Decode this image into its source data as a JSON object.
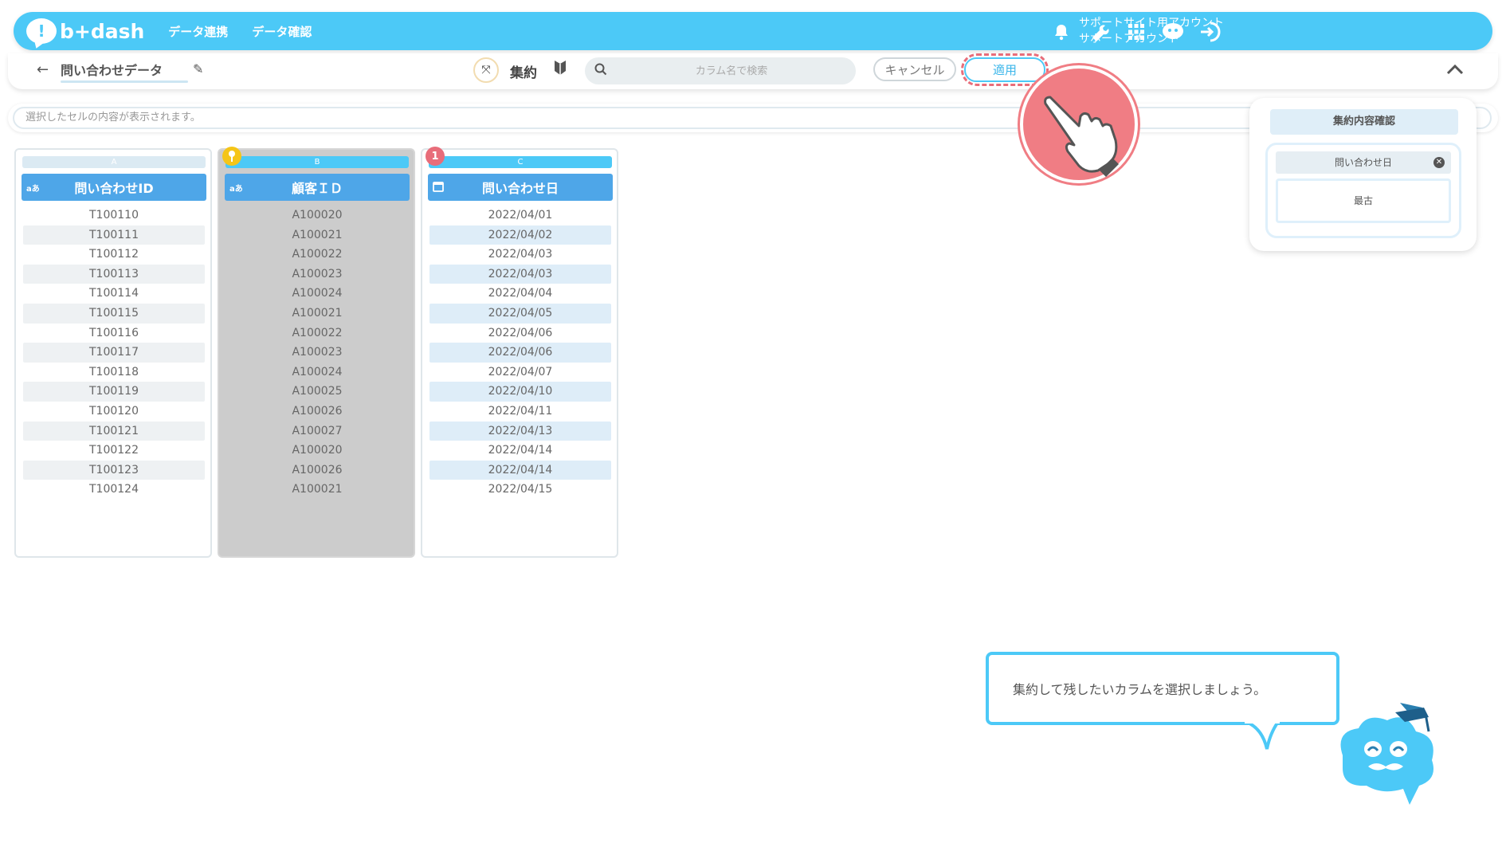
{
  "header": {
    "logo_text": "b+dash",
    "nav": [
      "データ連携",
      "データ確認"
    ],
    "account_line1": "サポートサイト用アカウント",
    "account_line2": "サポートアカウント"
  },
  "toolbar": {
    "page_title": "問い合わせデータ",
    "aggregate_label": "集約",
    "search_placeholder": "カラム名で検索",
    "cancel_label": "キャンセル",
    "apply_label": "適用"
  },
  "cell_content_placeholder": "選択したセルの内容が表示されます。",
  "columns": [
    {
      "letter": "A",
      "type_label": "aあ",
      "name": "問い合わせID",
      "values": [
        "T100110",
        "T100111",
        "T100112",
        "T100113",
        "T100114",
        "T100115",
        "T100116",
        "T100117",
        "T100118",
        "T100119",
        "T100120",
        "T100121",
        "T100122",
        "T100123",
        "T100124"
      ]
    },
    {
      "letter": "B",
      "type_label": "aあ",
      "name": "顧客ＩＤ",
      "values": [
        "A100020",
        "A100021",
        "A100022",
        "A100023",
        "A100024",
        "A100021",
        "A100022",
        "A100023",
        "A100024",
        "A100025",
        "A100026",
        "A100027",
        "A100020",
        "A100026",
        "A100021"
      ]
    },
    {
      "letter": "C",
      "badge": "1",
      "name": "問い合わせ日",
      "values": [
        "2022/04/01",
        "2022/04/02",
        "2022/04/03",
        "2022/04/03",
        "2022/04/04",
        "2022/04/05",
        "2022/04/06",
        "2022/04/06",
        "2022/04/07",
        "2022/04/10",
        "2022/04/11",
        "2022/04/13",
        "2022/04/14",
        "2022/04/14",
        "2022/04/15"
      ]
    }
  ],
  "panel": {
    "title": "集約内容確認",
    "field": "問い合わせ日",
    "value": "最古"
  },
  "hint": {
    "text": "集約して残したいカラムを選択しましょう。"
  },
  "colors": {
    "accent": "#4cc9f7",
    "header_blue": "#4ea6e8",
    "highlight_red": "#e86d7a"
  }
}
